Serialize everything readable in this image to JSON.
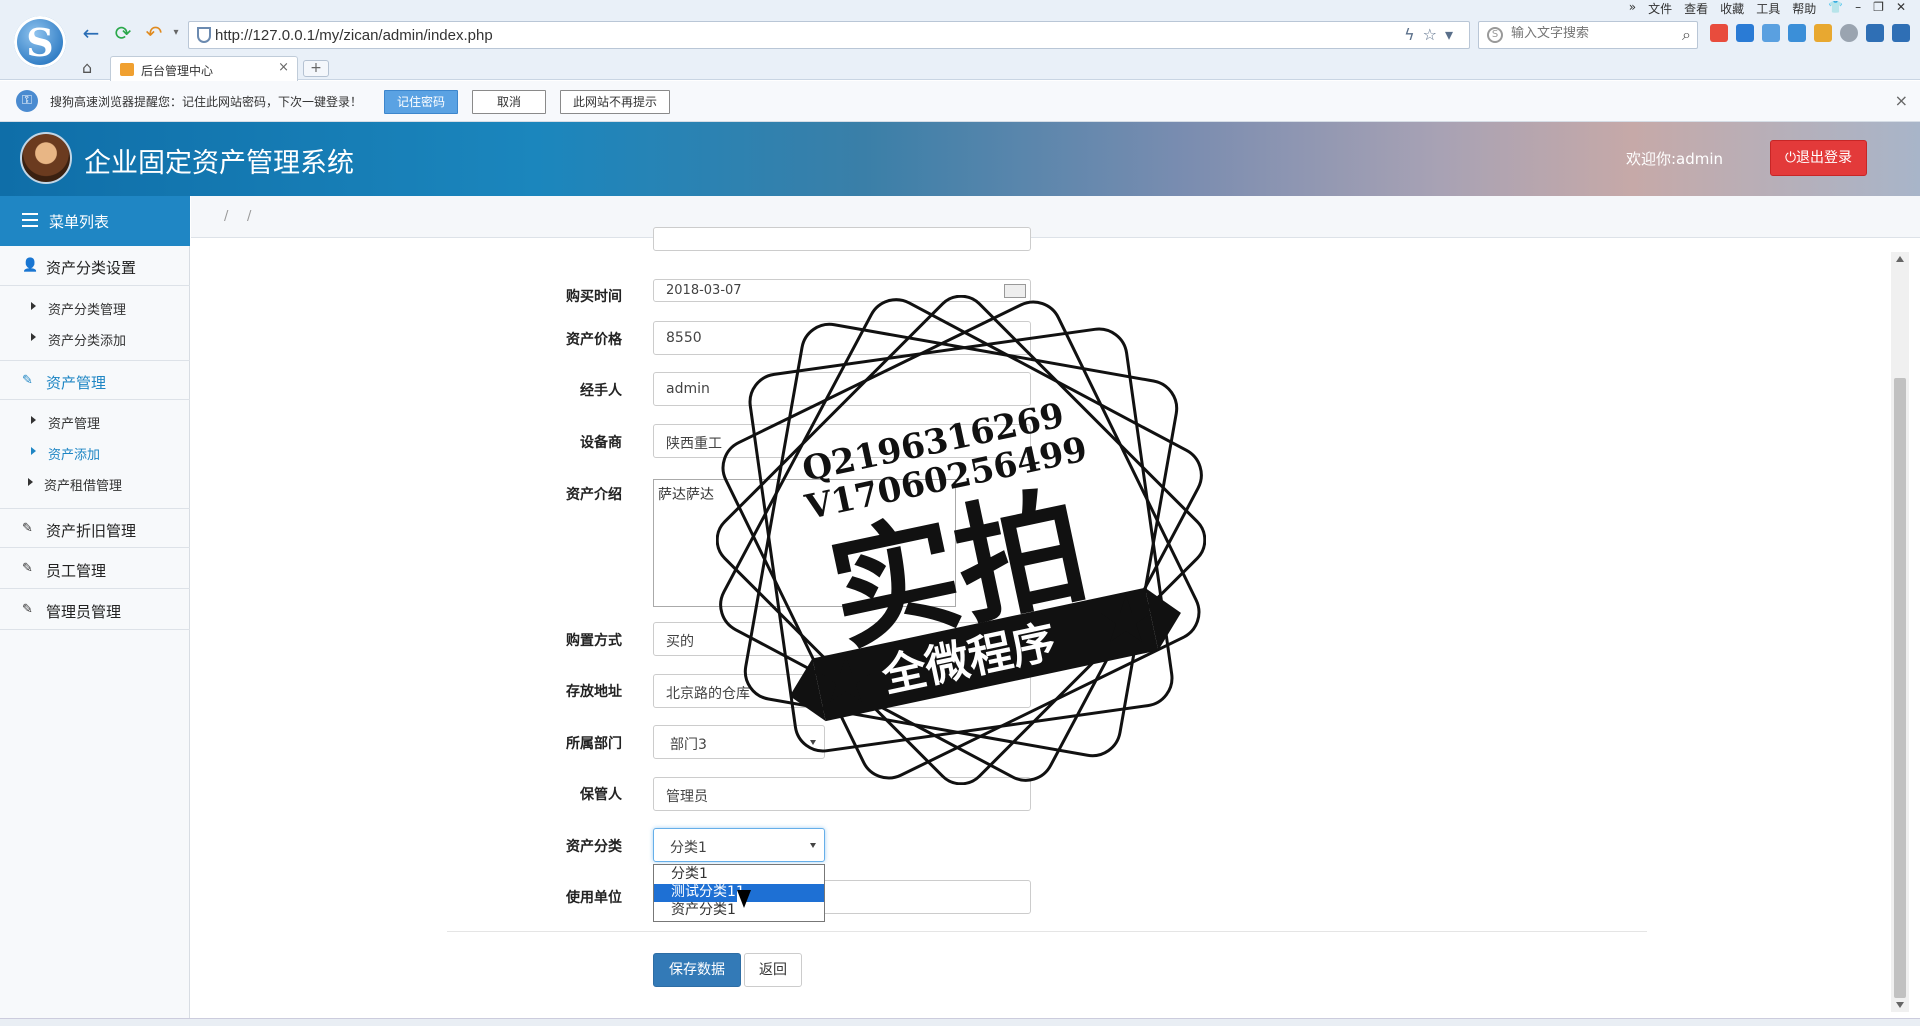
{
  "browser": {
    "address_url": "http://127.0.0.1/my/zican/admin/index.php",
    "search_placeholder": "输入文字搜索",
    "top_menu": [
      "文件",
      "查看",
      "收藏",
      "工具",
      "帮助"
    ],
    "tab_title": "后台管理中心",
    "tab_close": "×",
    "new_tab": "+",
    "password_bar": {
      "message": "搜狗高速浏览器提醒您：记住此网站密码，下次一键登录！",
      "remember": "记住密码",
      "cancel": "取消",
      "never": "此网站不再提示",
      "close": "×"
    }
  },
  "app": {
    "title": "企业固定资产管理系统",
    "welcome": "欢迎你:admin",
    "logout": "退出登录"
  },
  "sidebar": {
    "header": "菜单列表",
    "group1": "资产分类设置",
    "g1_items": [
      "资产分类管理",
      "资产分类添加"
    ],
    "group2": "资产管理",
    "g2_items": [
      "资产管理",
      "资产添加",
      "资产租借管理"
    ],
    "group3": "资产折旧管理",
    "group4": "员工管理",
    "group5": "管理员管理"
  },
  "breadcrumb": [
    "/",
    "/"
  ],
  "form": {
    "buy_time_label": "购买时间",
    "buy_time_value": "2018-03-07",
    "price_label": "资产价格",
    "price_value": "8550",
    "handler_label": "经手人",
    "handler_value": "admin",
    "vendor_label": "设备商",
    "vendor_value": "陕西重工",
    "intro_label": "资产介绍",
    "intro_value": "萨达萨达",
    "method_label": "购置方式",
    "method_value": "买的",
    "location_label": "存放地址",
    "location_value": "北京路的仓库",
    "dept_label": "所属部门",
    "dept_value": "部门3",
    "keeper_label": "保管人",
    "keeper_value": "管理员",
    "category_label": "资产分类",
    "category_value": "分类1",
    "category_options": [
      "分类1",
      "测试分类11",
      "资产分类1"
    ],
    "unit_label": "使用单位",
    "save": "保存数据",
    "back": "返回"
  },
  "watermark": {
    "line1": "Q2196316269",
    "line2": "V17060256499",
    "big": "实拍",
    "ribbon": "全微程序"
  },
  "colors": {
    "primary": "#337ab7",
    "sidebar_accent": "#1f86c4",
    "logout_red": "#e33a3a",
    "dropdown_selected": "#1e70d4"
  }
}
